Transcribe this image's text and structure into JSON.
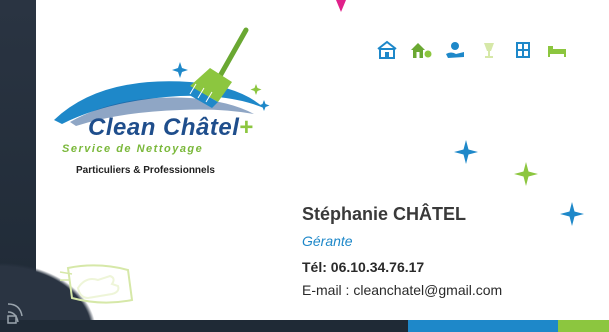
{
  "logo": {
    "title": "Clean Châtel",
    "plus": "+",
    "tagline": "Service de Nettoyage",
    "subtitle": "Particuliers & Professionnels"
  },
  "contact": {
    "name": "Stéphanie CHÂTEL",
    "role": "Gérante",
    "phone": "Tél: 06.10.34.76.17",
    "email": "E-mail : cleanchatel@gmail.com"
  },
  "icons": [
    "house-icon",
    "house-garden-icon",
    "hand-care-icon",
    "glass-icon",
    "window-icon",
    "bed-icon"
  ],
  "colors": {
    "navy": "#1f2a36",
    "blue": "#1e88c9",
    "green": "#8cc63f",
    "logo_blue": "#1f4e8c",
    "pink": "#e0218a"
  }
}
